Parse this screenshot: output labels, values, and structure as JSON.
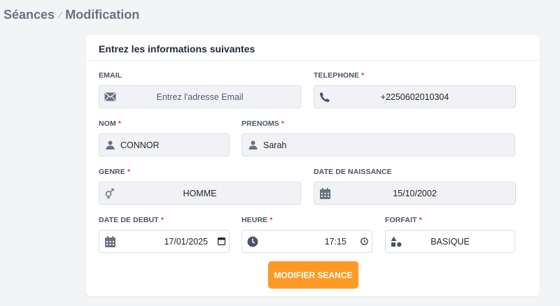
{
  "breadcrumb": {
    "parent": "Séances",
    "current": "Modification"
  },
  "card": {
    "title": "Entrez les informations suivantes"
  },
  "form": {
    "email": {
      "label": "EMAIL",
      "placeholder": "Entrez l'adresse  Email",
      "icon": "envelope-icon"
    },
    "telephone": {
      "label": "TELEPHONE",
      "value": "+2250602010304",
      "icon": "phone-icon"
    },
    "nom": {
      "label": "NOM",
      "value": "CONNOR",
      "icon": "user-icon"
    },
    "prenoms": {
      "label": "PRENOMS",
      "value": "Sarah",
      "icon": "user-icon"
    },
    "genre": {
      "label": "GENRE",
      "value": "HOMME",
      "icon": "gender-icon"
    },
    "date_naissance": {
      "label": "DATE DE NAISSANCE",
      "value": "15/10/2002",
      "icon": "calendar-icon"
    },
    "date_debut": {
      "label": "DATE DE DEBUT",
      "value": "17/01/2025",
      "icon": "calendar-icon"
    },
    "heure": {
      "label": "HEURE",
      "value": "17:15",
      "icon": "clock-icon"
    },
    "forfait": {
      "label": "FORFAIT",
      "value": "BASIQUE",
      "icon": "shapes-icon"
    },
    "required_mark": "*"
  },
  "submit_label": "MODIFIER SEANCE",
  "colors": {
    "accent": "#fd9a26",
    "required": "#dc3545",
    "field_bg": "#f1f2f6"
  }
}
